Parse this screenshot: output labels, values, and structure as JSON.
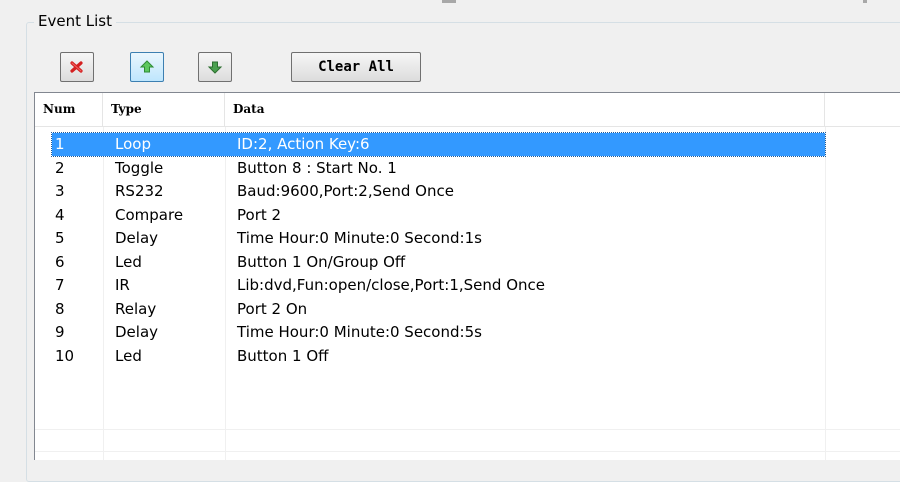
{
  "group": {
    "title": "Event List"
  },
  "toolbar": {
    "delete_icon": "delete-icon",
    "up_icon": "arrow-up-icon",
    "down_icon": "arrow-down-icon",
    "clear_label": "Clear All"
  },
  "table": {
    "columns": [
      "Num",
      "Type",
      "Data"
    ],
    "rows": [
      {
        "num": "1",
        "type": "Loop",
        "data": "ID:2, Action Key:6"
      },
      {
        "num": "2",
        "type": "Toggle",
        "data": "Button 8 : Start No. 1"
      },
      {
        "num": "3",
        "type": "RS232",
        "data": "Baud:9600,Port:2,Send Once"
      },
      {
        "num": "4",
        "type": "Compare",
        "data": "Port 2"
      },
      {
        "num": "5",
        "type": "Delay",
        "data": "Time Hour:0 Minute:0 Second:1s"
      },
      {
        "num": "6",
        "type": "Led",
        "data": "Button 1 On/Group Off"
      },
      {
        "num": "7",
        "type": "IR",
        "data": "Lib:dvd,Fun:open/close,Port:1,Send Once"
      },
      {
        "num": "8",
        "type": "Relay",
        "data": "Port 2 On"
      },
      {
        "num": "9",
        "type": "Delay",
        "data": "Time Hour:0 Minute:0 Second:5s"
      },
      {
        "num": "10",
        "type": "Led",
        "data": "Button 1 Off"
      }
    ],
    "selected_row": 0
  },
  "colors": {
    "selection": "#3399ff",
    "delete_icon": "#d42020",
    "up_icon": "#3cb043",
    "down_icon": "#3a8a3a"
  }
}
